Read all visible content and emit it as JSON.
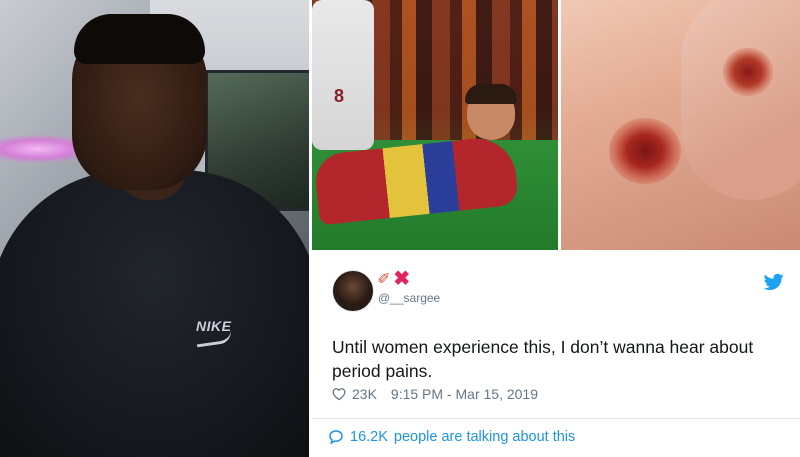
{
  "left_photo": {
    "logo_text": "NIKE"
  },
  "middle_photo": {
    "jersey_number": "8"
  },
  "tweet": {
    "emoji_names": [
      "pencil-icon",
      "cross-mark-icon"
    ],
    "handle": "@__sargee",
    "text": "Until women experience this, I don’t wanna hear about period pains.",
    "likes": "23K",
    "timestamp": "9:15 PM - Mar 15, 2019",
    "talking_count": "16.2K",
    "talking_text": "people are talking about this",
    "colors": {
      "accent": "#1b95e0",
      "muted": "#657786",
      "text": "#14171a",
      "divider": "#e1e8ed"
    }
  }
}
